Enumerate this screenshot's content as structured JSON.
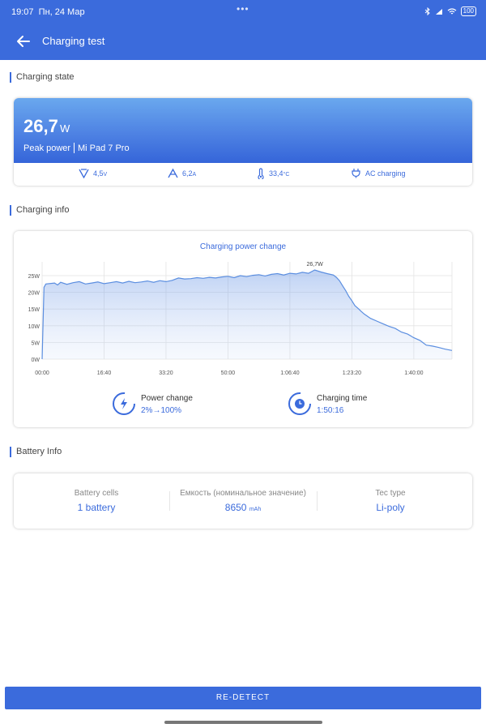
{
  "status_bar": {
    "time": "19:07",
    "date": "Пн, 24 Мар",
    "battery": "100"
  },
  "header": {
    "title": "Charging test"
  },
  "sections": {
    "state": "Charging state",
    "info": "Charging info",
    "battery": "Battery Info"
  },
  "charging_state": {
    "power_value": "26,7",
    "power_unit": "W",
    "peak_label": "Peak power",
    "device": "Mi Pad 7 Pro",
    "voltage": "4,5",
    "voltage_unit": "V",
    "current": "6,2",
    "current_unit": "A",
    "temperature": "33,4",
    "temperature_unit": "°C",
    "charger": "AC charging"
  },
  "charging_info": {
    "power_change_label": "Power change",
    "power_change_value": "2%→100%",
    "charging_time_label": "Charging time",
    "charging_time_value": "1:50:16"
  },
  "chart_data": {
    "type": "area",
    "title": "Charging power change",
    "x_ticks": [
      "00:00",
      "16:40",
      "33:20",
      "50:00",
      "1:06:40",
      "1:23:20",
      "1:40:00"
    ],
    "y_ticks": [
      "0W",
      "5W",
      "10W",
      "15W",
      "20W",
      "25W"
    ],
    "ylim": [
      0,
      28
    ],
    "xlim": [
      0,
      6616
    ],
    "peak_label": "26,7W",
    "peak": [
      4400,
      26.7
    ],
    "x": [
      0,
      30,
      60,
      200,
      250,
      300,
      400,
      500,
      600,
      700,
      800,
      900,
      1000,
      1100,
      1200,
      1300,
      1400,
      1500,
      1600,
      1700,
      1800,
      1900,
      2000,
      2100,
      2200,
      2300,
      2400,
      2500,
      2600,
      2700,
      2800,
      2900,
      3000,
      3100,
      3200,
      3300,
      3400,
      3500,
      3600,
      3700,
      3800,
      3900,
      4000,
      4100,
      4200,
      4300,
      4400,
      4500,
      4600,
      4700,
      4750,
      4800,
      4850,
      4900,
      4950,
      5000,
      5050,
      5100,
      5150,
      5200,
      5300,
      5400,
      5500,
      5600,
      5700,
      5800,
      5900,
      6000,
      6100,
      6200,
      6300,
      6400,
      6500,
      6616
    ],
    "y": [
      0,
      21.5,
      22.5,
      22.8,
      22.2,
      23,
      22.4,
      22.9,
      23.2,
      22.5,
      22.8,
      23.1,
      22.6,
      22.9,
      23.2,
      22.8,
      23.3,
      22.9,
      23.1,
      23.4,
      23.0,
      23.5,
      23.2,
      23.6,
      24.3,
      24.0,
      24.1,
      24.4,
      24.2,
      24.5,
      24.3,
      24.6,
      24.8,
      24.4,
      25.0,
      24.7,
      25.1,
      25.3,
      24.9,
      25.4,
      25.6,
      25.2,
      25.7,
      25.5,
      26.0,
      25.7,
      26.7,
      26.1,
      25.6,
      25.2,
      24.5,
      23.5,
      22.0,
      20.5,
      18.8,
      17.5,
      16.0,
      15.2,
      14.3,
      13.5,
      12.2,
      11.4,
      10.6,
      9.8,
      9.2,
      8.1,
      7.5,
      6.4,
      5.6,
      4.2,
      3.9,
      3.5,
      3.0,
      2.6
    ]
  },
  "battery_info": {
    "cells_label": "Battery cells",
    "cells_value": "1 battery",
    "capacity_label": "Емкость (номинальное значение)",
    "capacity_value": "8650",
    "capacity_unit": "mAh",
    "tec_label": "Tec type",
    "tec_value": "Li-poly"
  },
  "actions": {
    "redetect": "RE-DETECT"
  },
  "colors": {
    "accent": "#3b6bdc",
    "line": "#5b8ee0"
  }
}
